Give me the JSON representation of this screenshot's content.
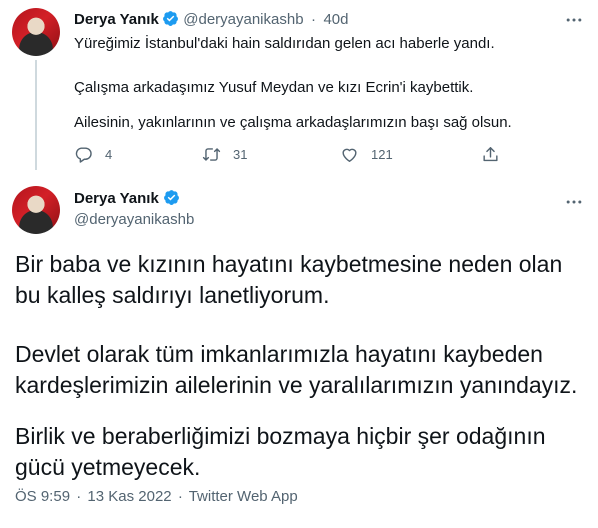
{
  "colors": {
    "verified_blue": "#1d9bf0",
    "muted_text": "#536471",
    "primary_text": "#0f1419",
    "thread_line": "#cfd9de"
  },
  "reply_tweet": {
    "author_name": "Derya Yanık",
    "handle": "@deryayanikashb",
    "separator": "·",
    "age": "40d",
    "paragraphs": [
      "Yüreğimiz İstanbul'daki hain saldırıdan gelen acı haberle yandı.",
      "Çalışma arkadaşımız Yusuf Meydan ve kızı Ecrin'i kaybettik.",
      "Ailesinin, yakınlarının ve çalışma arkadaşlarımızın başı sağ olsun."
    ],
    "actions": {
      "reply_icon": "reply-bubble-icon",
      "reply_count": "4",
      "retweet_icon": "retweet-icon",
      "retweet_count": "31",
      "like_icon": "heart-icon",
      "like_count": "121",
      "share_icon": "share-upload-icon"
    }
  },
  "main_tweet": {
    "author_name": "Derya Yanık",
    "handle": "@deryayanikashb",
    "paragraphs": [
      [
        "Bir baba ve kızının hayatını kaybetmesine neden olan",
        "bu kalleş saldırıyı lanetliyorum."
      ],
      [
        "Devlet olarak tüm imkanlarımızla hayatını kaybeden",
        "kardeşlerimizin ailelerinin ve yaralılarımızın yanındayız."
      ],
      [
        "Birlik ve beraberliğimizi bozmaya hiçbir şer odağının",
        "gücü yetmeyecek."
      ]
    ],
    "meta": {
      "time": "ÖS 9:59",
      "separator": "·",
      "date": "13 Kas 2022",
      "source": "Twitter Web App"
    }
  }
}
